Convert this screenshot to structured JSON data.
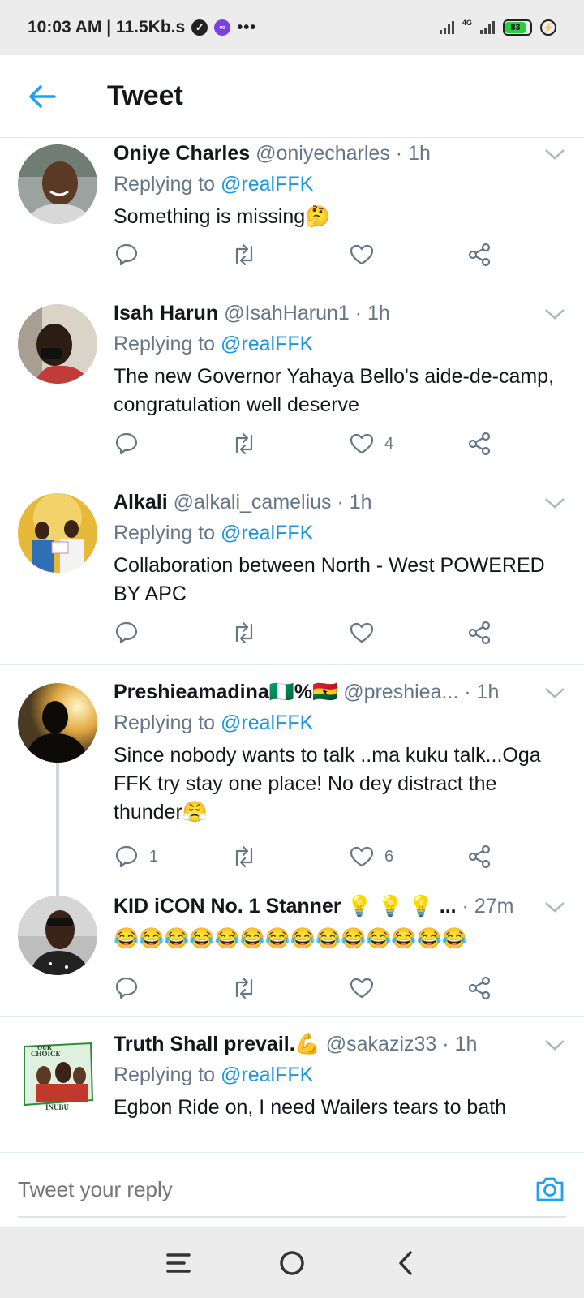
{
  "status_bar": {
    "time_speed": "10:03 AM | 11.5Kb.s",
    "dots": "•••",
    "network": "4G",
    "battery": "83"
  },
  "header": {
    "title": "Tweet"
  },
  "tweets": [
    {
      "author": "Oniye Charles",
      "handle": "@oniyecharles",
      "time": "1h",
      "replying_prefix": "Replying to",
      "replying_to": "@realFFK",
      "text": "Something is missing🤔",
      "reply_count": "",
      "retweet_count": "",
      "like_count": ""
    },
    {
      "author": "Isah Harun",
      "handle": "@IsahHarun1",
      "time": "1h",
      "replying_prefix": "Replying to",
      "replying_to": "@realFFK",
      "text": "The new Governor Yahaya Bello's aide-de-camp, congratulation well deserve",
      "reply_count": "",
      "retweet_count": "",
      "like_count": "4"
    },
    {
      "author": "Alkali",
      "handle": "@alkali_camelius",
      "time": "1h",
      "replying_prefix": "Replying to",
      "replying_to": "@realFFK",
      "text": "Collaboration between North - West POWERED  BY APC",
      "reply_count": "",
      "retweet_count": "",
      "like_count": ""
    },
    {
      "author": "Preshieamadina🇳🇬%🇬🇭",
      "handle": "@preshiea...",
      "time": "1h",
      "replying_prefix": "Replying to",
      "replying_to": "@realFFK",
      "text": "Since nobody wants to talk ..ma kuku talk...Oga FFK try stay one place! No dey distract the thunder😤",
      "reply_count": "1",
      "retweet_count": "",
      "like_count": "6"
    },
    {
      "author": "KID iCON No. 1 Stanner 💡 💡 💡 ...",
      "handle": "",
      "time": "27m",
      "replying_prefix": "",
      "replying_to": "",
      "text": "😂😂😂😂😂😂😂😂😂😂😂😂😂😂",
      "reply_count": "",
      "retweet_count": "",
      "like_count": ""
    },
    {
      "author": "Truth Shall prevail.💪",
      "handle": "@sakaziz33",
      "time": "1h",
      "replying_prefix": "Replying to",
      "replying_to": "@realFFK",
      "text": "Egbon Ride on, I need Wailers tears to bath",
      "reply_count": "",
      "retweet_count": "",
      "like_count": ""
    }
  ],
  "avatar_poster": {
    "line1": "OUR",
    "line2": "CHOICE",
    "line3": "INUBU"
  },
  "reply_bar": {
    "placeholder": "Tweet your reply"
  },
  "colors": {
    "accent": "#1da1f2",
    "mention": "#1b95e0",
    "secondary_text": "#657786",
    "divider": "#e1e8ed"
  },
  "icons": {
    "back": "arrow-left-icon",
    "reply": "comment-icon",
    "retweet": "retweet-icon",
    "like": "heart-icon",
    "share": "share-icon",
    "caret": "chevron-down-icon",
    "camera": "camera-icon"
  }
}
